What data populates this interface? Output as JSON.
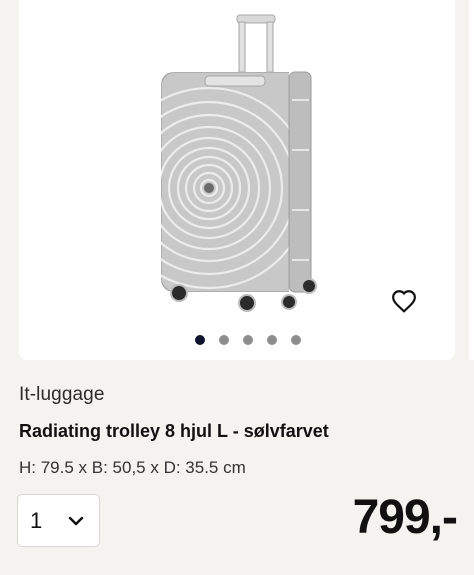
{
  "product": {
    "brand": "It-luggage",
    "title": "Radiating trolley 8 hjul L - sølvfarvet",
    "dimensions": "H: 79.5 x B: 50,5 x D: 35.5 cm",
    "price": "799,-"
  },
  "quantity": {
    "selected": "1"
  },
  "carousel": {
    "total": 5,
    "active_index": 0
  },
  "icons": {
    "wishlist": "heart-outline-icon",
    "dropdown": "chevron-down-icon"
  },
  "colors": {
    "active_dot": "#0e1430",
    "inactive_dot": "#8c8c8c",
    "background": "#f4f3f0"
  }
}
